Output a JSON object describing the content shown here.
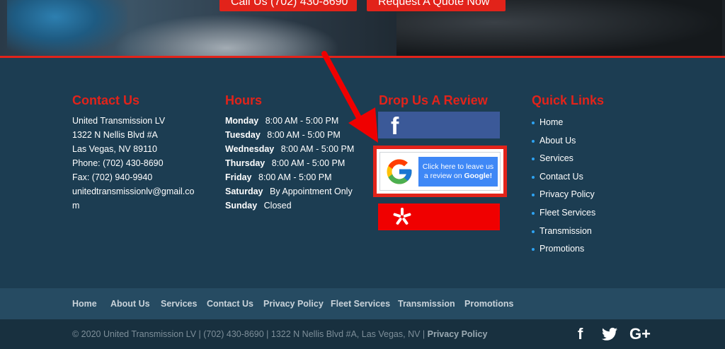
{
  "hero": {
    "call_button": "Call Us (702) 430-8690",
    "quote_button": "Request A Quote Now"
  },
  "contact": {
    "title": "Contact Us",
    "lines": [
      "United Transmission LV",
      "1322 N Nellis Blvd #A",
      "Las Vegas, NV 89110",
      "Phone: (702) 430-8690",
      "Fax: (702) 940-9940",
      "unitedtransmissionlv@gmail.co",
      "m"
    ]
  },
  "hours": {
    "title": "Hours",
    "rows": [
      {
        "day": "Monday",
        "time": "8:00 AM - 5:00 PM"
      },
      {
        "day": "Tuesday",
        "time": "8:00 AM - 5:00 PM"
      },
      {
        "day": "Wednesday",
        "time": "8:00 AM - 5:00 PM"
      },
      {
        "day": "Thursday",
        "time": "8:00 AM - 5:00 PM"
      },
      {
        "day": "Friday",
        "time": "8:00 AM - 5:00 PM"
      },
      {
        "day": "Saturday",
        "time": "By Appointment Only"
      },
      {
        "day": "Sunday",
        "time": "Closed"
      }
    ]
  },
  "review": {
    "title": "Drop Us A Review",
    "google_line1": "Click here to leave us",
    "google_line2_prefix": "a review on ",
    "google_line2_bold": "Google!",
    "facebook_icon": "facebook-icon",
    "yelp_icon": "yelp-icon"
  },
  "quick_links": {
    "title": "Quick Links",
    "items": [
      "Home",
      "About Us",
      "Services",
      "Contact Us",
      "Privacy Policy",
      "Fleet Services",
      "Transmission",
      "Promotions"
    ]
  },
  "footer_nav": [
    "Home",
    "About Us",
    "Services",
    "Contact Us",
    "Privacy Policy",
    "Fleet Services",
    "Transmission",
    "Promotions"
  ],
  "bottom": {
    "copyright": "© 2020 United Transmission LV | (702) 430-8690 | 1322 N Nellis Blvd #A, Las Vegas, NV | ",
    "privacy_link": "Privacy Policy",
    "social": [
      "facebook-icon",
      "twitter-icon",
      "google-plus-icon"
    ]
  },
  "colors": {
    "accent_red": "#e2231a",
    "footer_bg": "#1c3d52",
    "facebook_blue": "#3b5998",
    "yelp_red": "#f00000",
    "google_blue": "#3f88f6",
    "bullet_blue": "#2ea3f2"
  }
}
